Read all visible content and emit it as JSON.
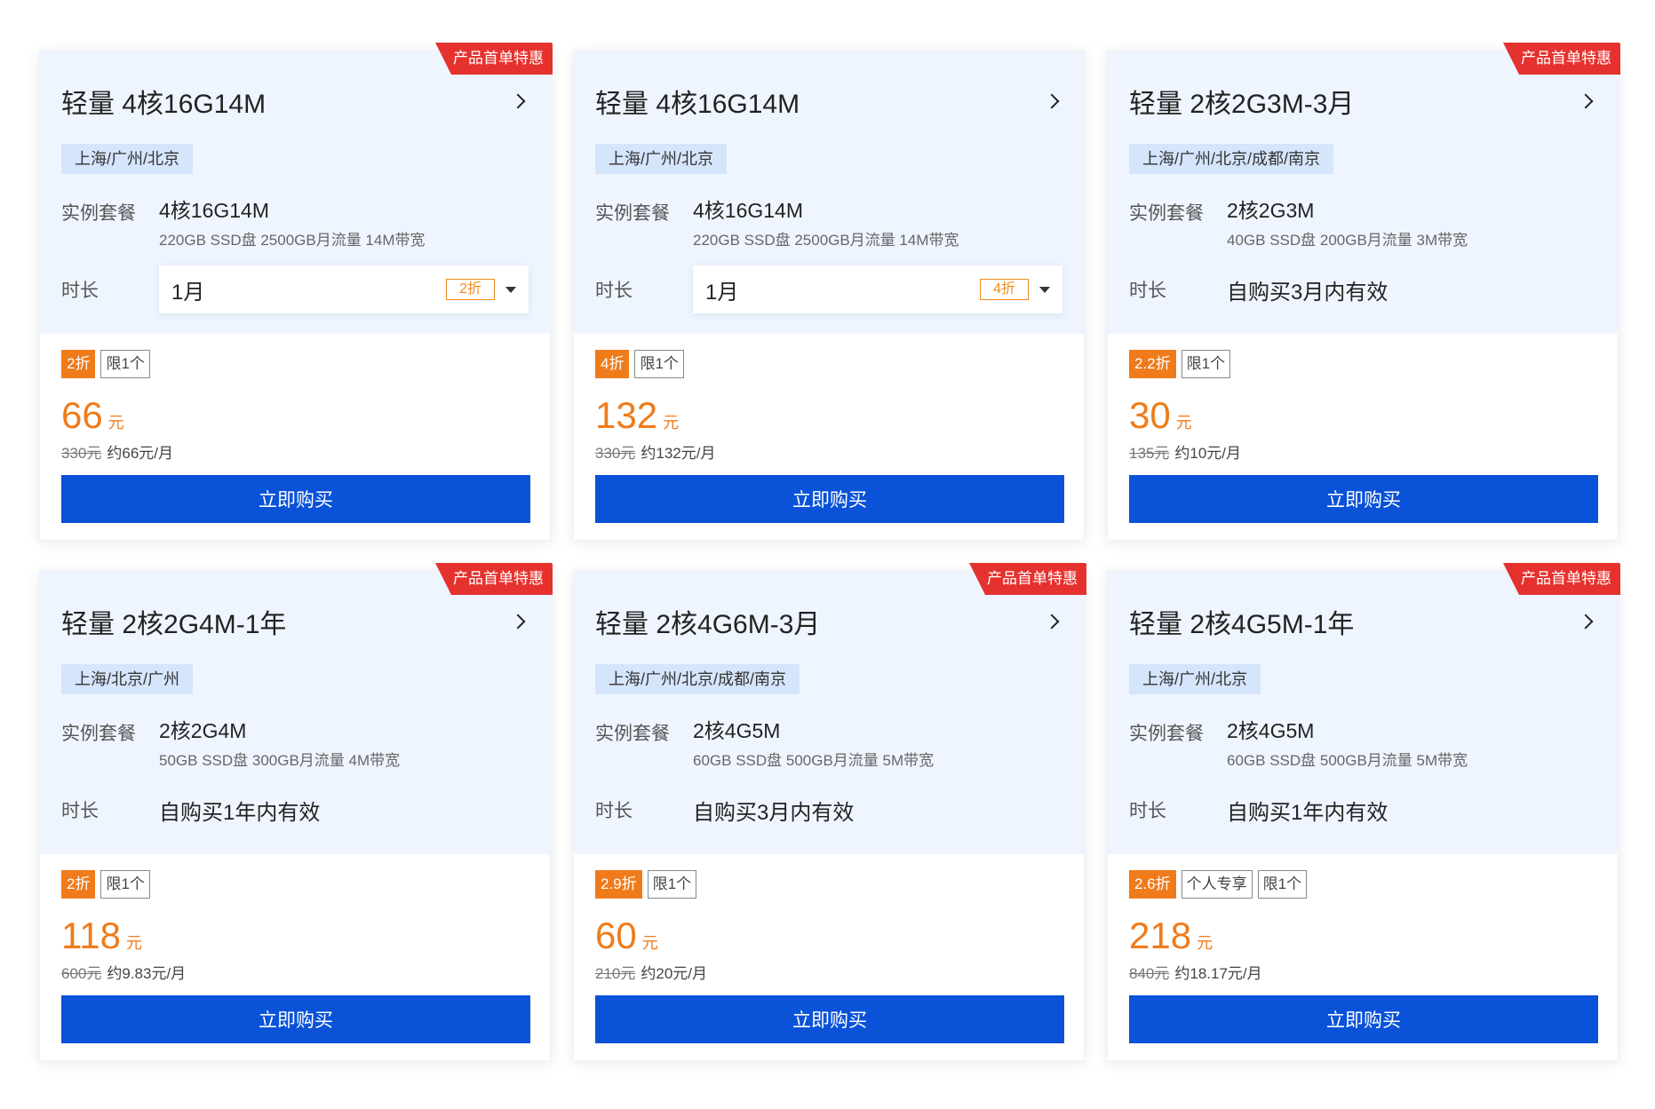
{
  "cards": [
    {
      "ribbon": "产品首单特惠",
      "title": "轻量 4核16G14M",
      "region": "上海/广州/北京",
      "spec_label": "实例套餐",
      "spec_main": "4核16G14M",
      "spec_sub": "220GB SSD盘 2500GB月流量 14M带宽",
      "duration_label": "时长",
      "duration_type": "select",
      "duration_value": "1月",
      "duration_discount": "2折",
      "tags": [
        {
          "text": "2折",
          "kind": "discount"
        },
        {
          "text": "限1个",
          "kind": "plain"
        }
      ],
      "price": "66",
      "price_unit": "元",
      "original_price": "330元",
      "monthly": "约66元/月",
      "buy_label": "立即购买"
    },
    {
      "ribbon": "",
      "title": "轻量 4核16G14M",
      "region": "上海/广州/北京",
      "spec_label": "实例套餐",
      "spec_main": "4核16G14M",
      "spec_sub": "220GB SSD盘 2500GB月流量 14M带宽",
      "duration_label": "时长",
      "duration_type": "select",
      "duration_value": "1月",
      "duration_discount": "4折",
      "tags": [
        {
          "text": "4折",
          "kind": "discount"
        },
        {
          "text": "限1个",
          "kind": "plain"
        }
      ],
      "price": "132",
      "price_unit": "元",
      "original_price": "330元",
      "monthly": "约132元/月",
      "buy_label": "立即购买"
    },
    {
      "ribbon": "产品首单特惠",
      "title": "轻量 2核2G3M-3月",
      "region": "上海/广州/北京/成都/南京",
      "spec_label": "实例套餐",
      "spec_main": "2核2G3M",
      "spec_sub": "40GB SSD盘 200GB月流量 3M带宽",
      "duration_label": "时长",
      "duration_type": "text",
      "duration_value": "自购买3月内有效",
      "duration_discount": "",
      "tags": [
        {
          "text": "2.2折",
          "kind": "discount"
        },
        {
          "text": "限1个",
          "kind": "plain"
        }
      ],
      "price": "30",
      "price_unit": "元",
      "original_price": "135元",
      "monthly": "约10元/月",
      "buy_label": "立即购买"
    },
    {
      "ribbon": "产品首单特惠",
      "title": "轻量 2核2G4M-1年",
      "region": "上海/北京/广州",
      "spec_label": "实例套餐",
      "spec_main": "2核2G4M",
      "spec_sub": "50GB SSD盘 300GB月流量 4M带宽",
      "duration_label": "时长",
      "duration_type": "text",
      "duration_value": "自购买1年内有效",
      "duration_discount": "",
      "tags": [
        {
          "text": "2折",
          "kind": "discount"
        },
        {
          "text": "限1个",
          "kind": "plain"
        }
      ],
      "price": "118",
      "price_unit": "元",
      "original_price": "600元",
      "monthly": "约9.83元/月",
      "buy_label": "立即购买"
    },
    {
      "ribbon": "产品首单特惠",
      "title": "轻量 2核4G6M-3月",
      "region": "上海/广州/北京/成都/南京",
      "spec_label": "实例套餐",
      "spec_main": "2核4G5M",
      "spec_sub": "60GB SSD盘 500GB月流量 5M带宽",
      "duration_label": "时长",
      "duration_type": "text",
      "duration_value": "自购买3月内有效",
      "duration_discount": "",
      "tags": [
        {
          "text": "2.9折",
          "kind": "discount"
        },
        {
          "text": "限1个",
          "kind": "plain"
        }
      ],
      "price": "60",
      "price_unit": "元",
      "original_price": "210元",
      "monthly": "约20元/月",
      "buy_label": "立即购买"
    },
    {
      "ribbon": "产品首单特惠",
      "title": "轻量 2核4G5M-1年",
      "region": "上海/广州/北京",
      "spec_label": "实例套餐",
      "spec_main": "2核4G5M",
      "spec_sub": "60GB SSD盘 500GB月流量 5M带宽",
      "duration_label": "时长",
      "duration_type": "text",
      "duration_value": "自购买1年内有效",
      "duration_discount": "",
      "tags": [
        {
          "text": "2.6折",
          "kind": "discount"
        },
        {
          "text": "个人专享",
          "kind": "plain"
        },
        {
          "text": "限1个",
          "kind": "plain"
        }
      ],
      "price": "218",
      "price_unit": "元",
      "original_price": "840元",
      "monthly": "约18.17元/月",
      "buy_label": "立即购买"
    }
  ],
  "colors": {
    "accent": "#0a52d8",
    "price": "#f07b1a",
    "ribbon": "#e5322e",
    "card_top": "#eff5ff",
    "region_tag": "#d5e5fb"
  }
}
